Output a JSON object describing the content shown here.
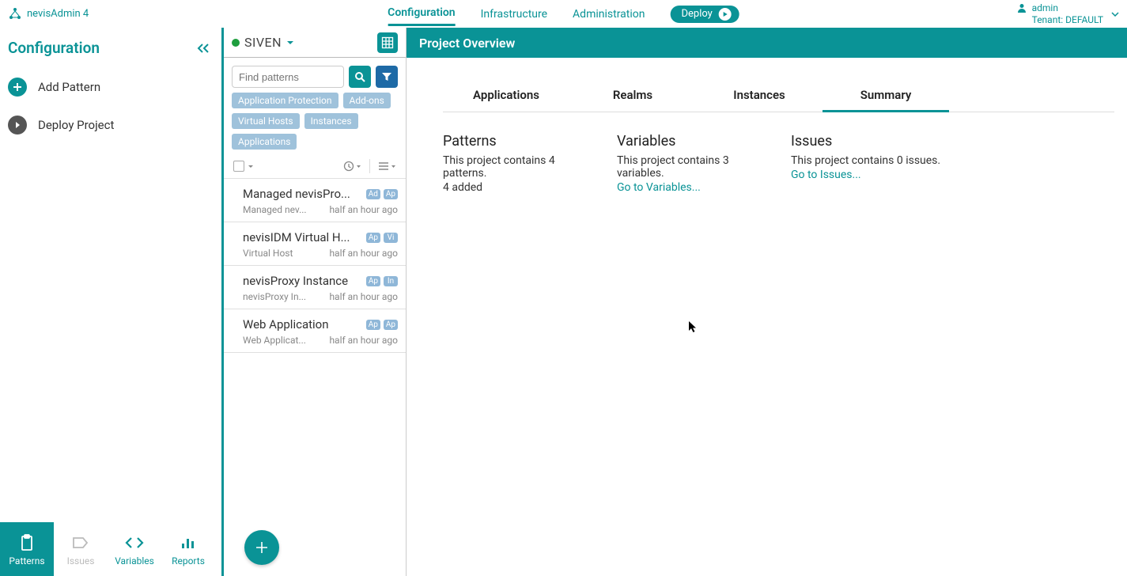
{
  "brand": "nevisAdmin 4",
  "topnav": {
    "configuration": "Configuration",
    "infrastructure": "Infrastructure",
    "administration": "Administration",
    "deploy": "Deploy"
  },
  "user": {
    "name": "admin",
    "tenant": "Tenant: DEFAULT"
  },
  "sidebar": {
    "title": "Configuration",
    "add": "Add Pattern",
    "deploy": "Deploy Project",
    "tabs": {
      "patterns": "Patterns",
      "issues": "Issues",
      "variables": "Variables",
      "reports": "Reports"
    }
  },
  "project": {
    "name": "SIVEN"
  },
  "search": {
    "placeholder": "Find patterns"
  },
  "chips": [
    "Application Protection",
    "Add-ons",
    "Virtual Hosts",
    "Instances",
    "Applications"
  ],
  "patterns": [
    {
      "name": "Managed nevisPro...",
      "sub": "Managed nev...",
      "time": "half an hour ago",
      "badges": [
        "Ad",
        "Ap"
      ]
    },
    {
      "name": "nevisIDM Virtual H...",
      "sub": "Virtual Host",
      "time": "half an hour ago",
      "badges": [
        "Ap",
        "Vi"
      ]
    },
    {
      "name": "nevisProxy Instance",
      "sub": "nevisProxy In...",
      "time": "half an hour ago",
      "badges": [
        "Ap",
        "In"
      ]
    },
    {
      "name": "Web Application",
      "sub": "Web Applicat...",
      "time": "half an hour ago",
      "badges": [
        "Ap",
        "Ap"
      ]
    }
  ],
  "overview": {
    "title": "Project Overview",
    "tabs": {
      "applications": "Applications",
      "realms": "Realms",
      "instances": "Instances",
      "summary": "Summary"
    },
    "patterns": {
      "h": "Patterns",
      "t": "This project contains 4 patterns.",
      "s": "4 added"
    },
    "variables": {
      "h": "Variables",
      "t": "This project contains 3 variables.",
      "link": "Go to Variables..."
    },
    "issues": {
      "h": "Issues",
      "t": "This project contains 0 issues.",
      "link": "Go to Issues..."
    }
  }
}
